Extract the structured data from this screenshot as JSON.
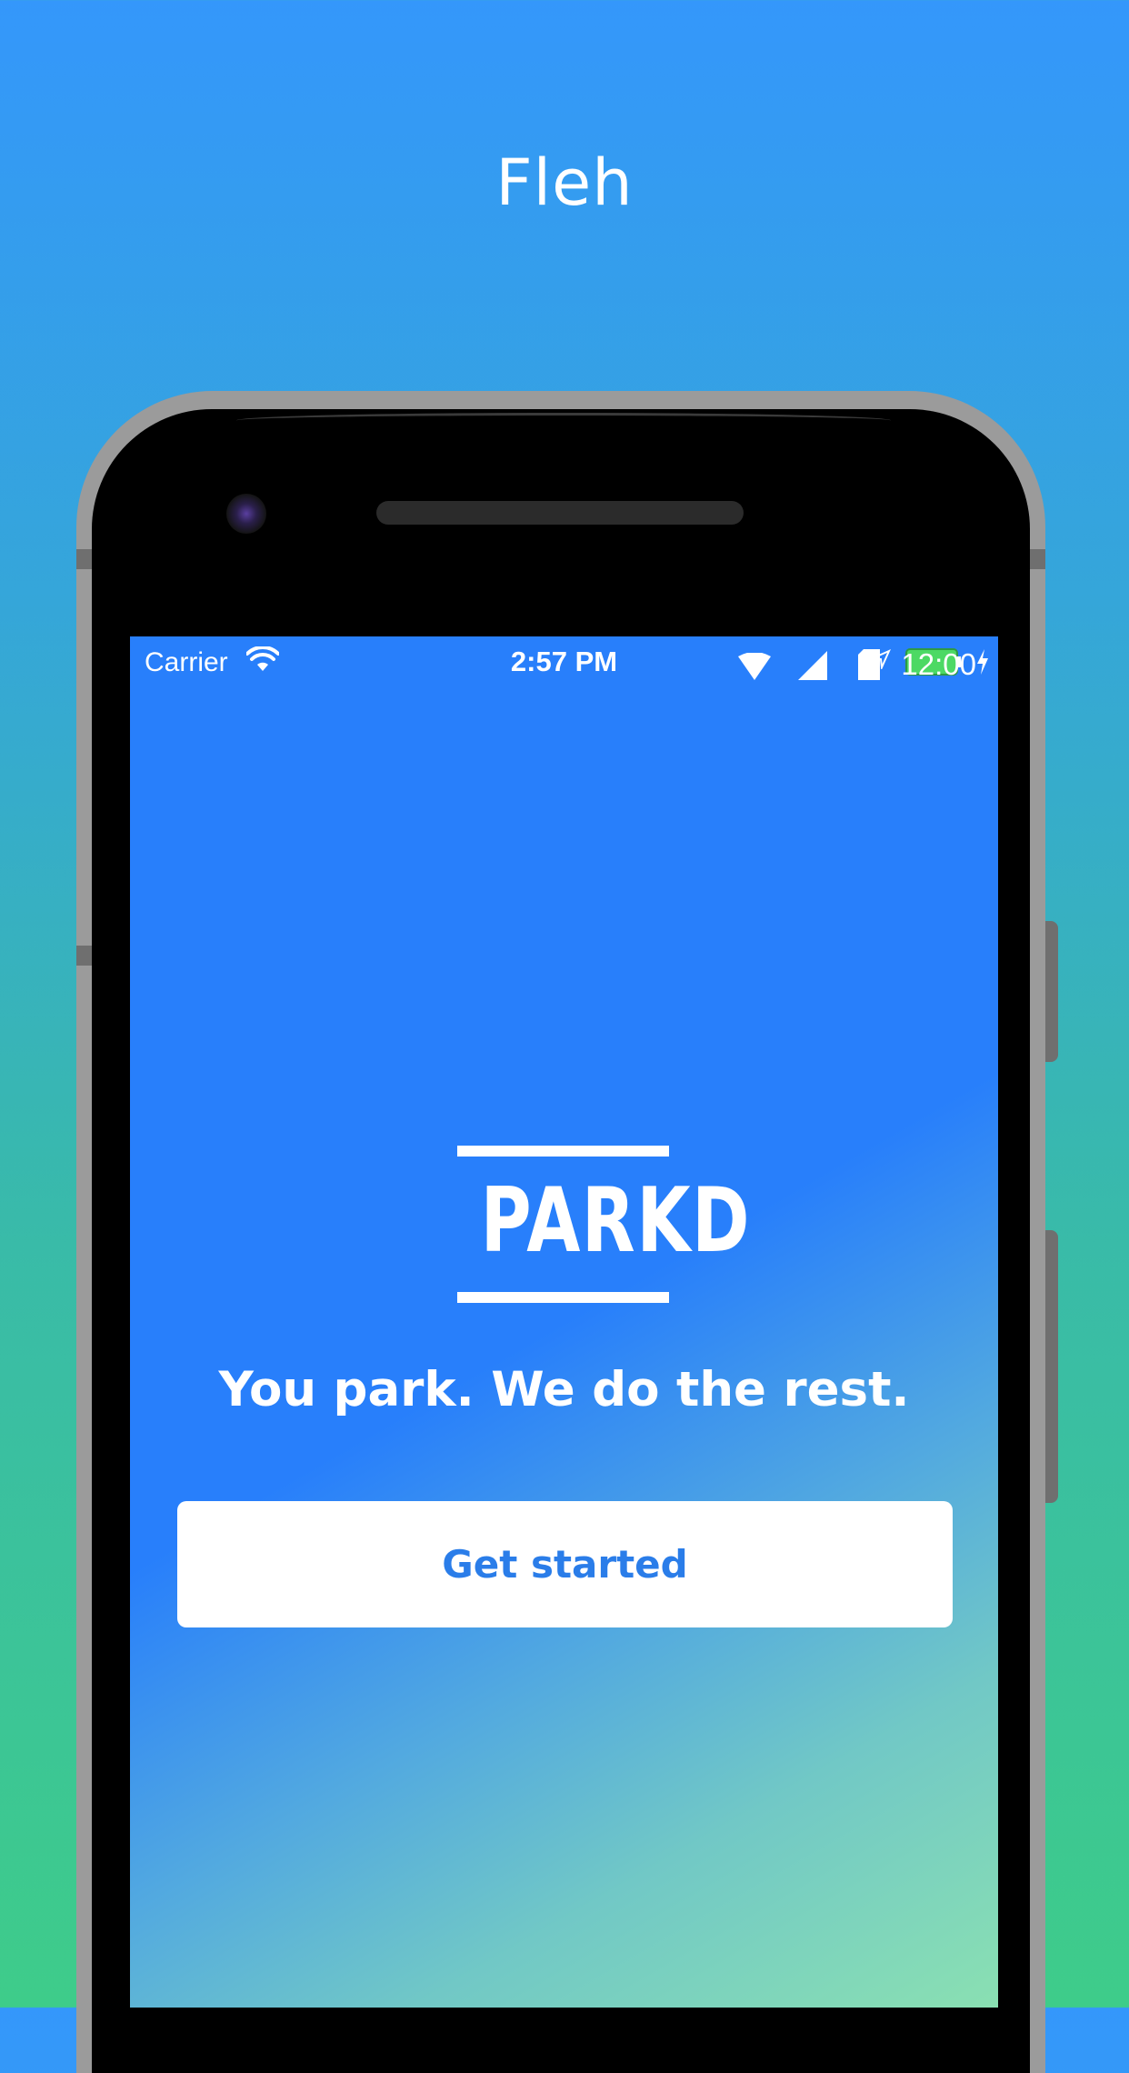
{
  "headline": "Fleh",
  "status_bar": {
    "carrier": "Carrier",
    "time": "2:57 PM",
    "android_time": "12:00"
  },
  "app": {
    "logo_text": "PARKD",
    "tagline": "You park. We do the rest.",
    "cta_label": "Get started"
  },
  "colors": {
    "screen_blue": "#287ffb",
    "cta_text": "#2a7de9",
    "background_top": "#3497fb",
    "background_bottom": "#3ecc8a"
  }
}
